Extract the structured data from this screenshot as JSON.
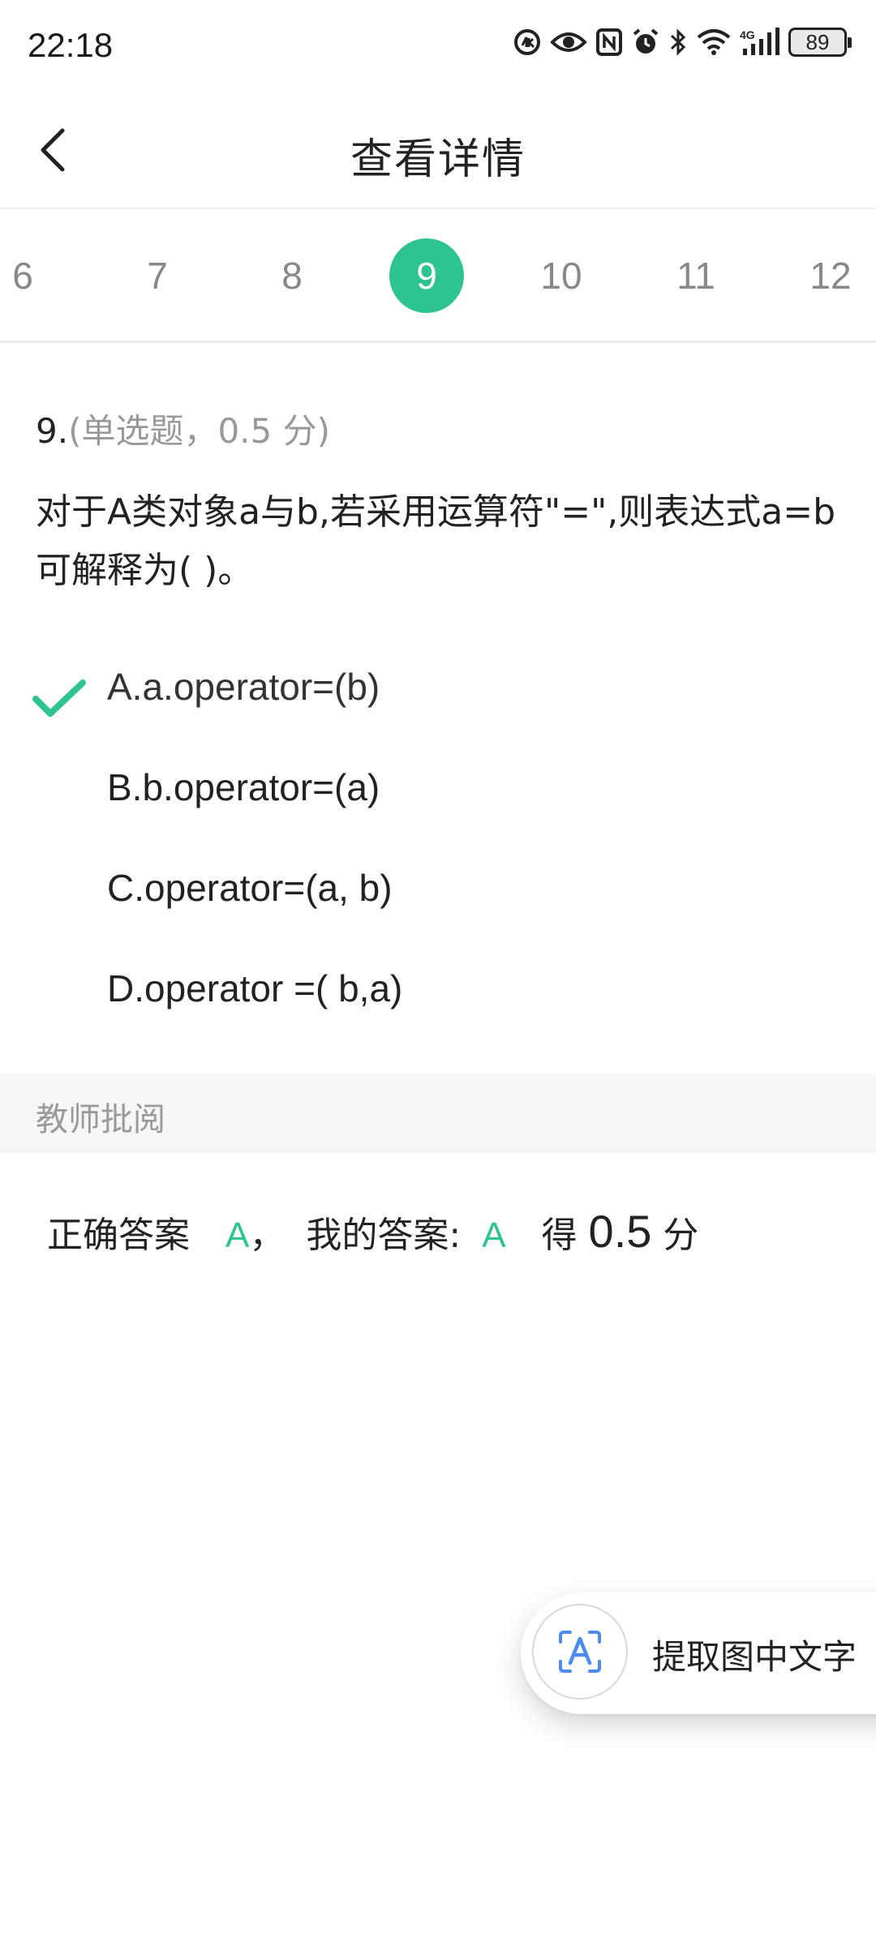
{
  "status_bar": {
    "time": "22:18",
    "battery": "89",
    "icons": [
      "data-saver-icon",
      "eye-icon",
      "nfc-icon",
      "alarm-icon",
      "bluetooth-icon",
      "wifi-icon",
      "4g-signal-icon",
      "battery-icon"
    ]
  },
  "header": {
    "title": "查看详情",
    "back_icon": "chevron-left-icon"
  },
  "num_tabs": {
    "items": [
      "6",
      "7",
      "8",
      "9",
      "10",
      "11",
      "12"
    ],
    "active": "9"
  },
  "question": {
    "number": "9.",
    "type_info": "(单选题，0.5 分)",
    "line1": "对于A类对象a与b,若采用运算符\"=\",则表达式a=b",
    "line2": "可解释为( )。",
    "options": [
      {
        "letter": "A.",
        "text": "a.operator=(b)",
        "selected": true
      },
      {
        "letter": "B.",
        "text": "b.operator=(a)",
        "selected": false
      },
      {
        "letter": "C.",
        "text": "operator=(a, b)",
        "selected": false
      },
      {
        "letter": "D.",
        "text": "operator =( b,a)",
        "selected": false
      }
    ]
  },
  "review": {
    "section_title": "教师批阅",
    "correct_label": "正确答案",
    "correct_value": "A",
    "comma": "，",
    "my_label": "我的答案:",
    "my_value": "A",
    "score_prefix": "得",
    "score": "0.5",
    "score_suffix": "分"
  },
  "float_button": {
    "label": "提取图中文字",
    "icon": "text-scan-icon"
  },
  "colors": {
    "accent_green": "#2ec48f",
    "muted_gray": "#999999",
    "tab_gray": "#888888"
  }
}
